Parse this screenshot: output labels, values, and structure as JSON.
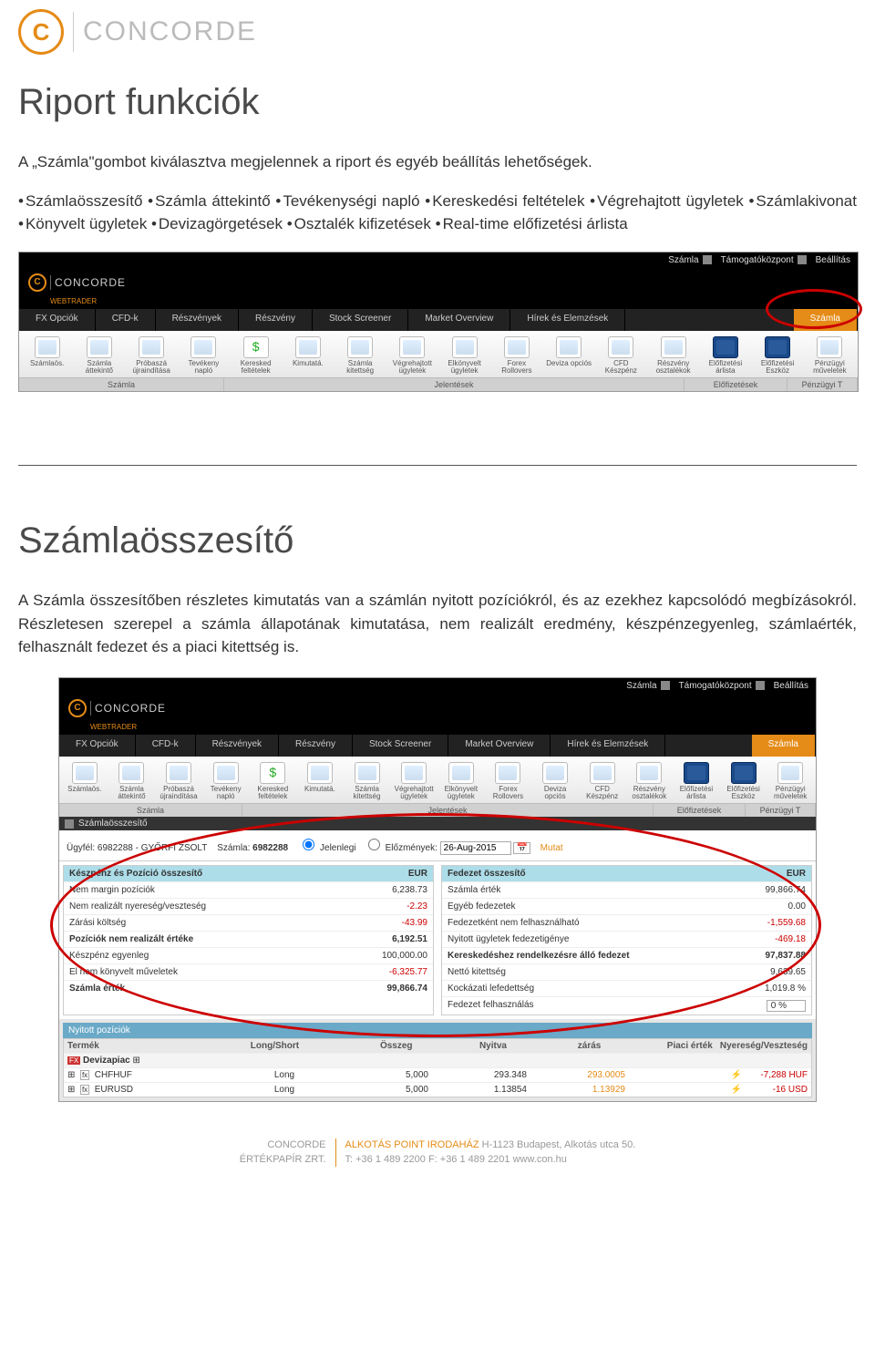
{
  "brand": {
    "name": "CONCORDE",
    "sub": "WEBTRADER"
  },
  "section1": {
    "title": "Riport funkciók",
    "intro": "A „Számla\"gombot kiválasztva megjelennek a riport és egyéb beállítás lehetőségek.",
    "bullets": [
      "Számlaösszesítő",
      "Számla áttekintő",
      "Tevékenységi napló",
      "Kereskedési feltételek",
      "Végrehajtott ügyletek",
      "Számlakivonat",
      "Könyvelt ügyletek",
      "Devizagörgetések",
      "Osztalék kifizetések",
      "Real-time előfizetési árlista"
    ]
  },
  "topbar": {
    "l1": "Számla",
    "l2": "Támogatóközpont",
    "l3": "Beállítás"
  },
  "tabs": [
    "FX Opciók",
    "CFD-k",
    "Részvények",
    "Részvény",
    "Stock Screener",
    "Market Overview",
    "Hírek és Elemzések",
    "Számla"
  ],
  "toolbar": [
    {
      "label": "Számlaös."
    },
    {
      "label": "Számla áttekintő"
    },
    {
      "label": "Próbaszá újraindítása"
    },
    {
      "label": "Tevékeny napló"
    },
    {
      "label": "Keresked feltételek"
    },
    {
      "label": "Kimutatá."
    },
    {
      "label": "Számla kitettség"
    },
    {
      "label": "Végrehajtott ügyletek"
    },
    {
      "label": "Elkönyvelt ügyletek"
    },
    {
      "label": "Forex Rollovers"
    },
    {
      "label": "Deviza opciós"
    },
    {
      "label": "CFD Készpénz"
    },
    {
      "label": "Részvény osztalékok"
    },
    {
      "label": "Előfizetési árlista"
    },
    {
      "label": "Előfizetési Eszköz"
    },
    {
      "label": "Pénzügyi műveletek"
    }
  ],
  "groups": {
    "g1": "Számla",
    "g2": "Jelentések",
    "g3": "Előfizetések",
    "g4": "Pénzügyi T"
  },
  "section2": {
    "title": "Számlaösszesítő",
    "body": "A Számla összesítőben részletes kimutatás van a számlán nyitott pozíciókról, és az ezekhez kapcsolódó megbízásokról. Részletesen szerepel a számla állapotának kimutatása, nem realizált eredmény, készpénzegyenleg, számlaérték, felhasznált fedezet és a piaci kitettség is."
  },
  "panel": {
    "title": "Számlaösszesítő",
    "filter": {
      "ugyfel_lbl": "Ügyfél:",
      "ugyfel_val": "6982288 - GYŐRFI ZSOLT",
      "szamla_lbl": "Számla:",
      "szamla_val": "6982288",
      "jelenl": "Jelenlegi",
      "elozm": "Előzmények:",
      "date": "26-Aug-2015",
      "mutat": "Mutat"
    }
  },
  "left": {
    "head": "Készpénz és Pozíció összesítő",
    "cur": "EUR",
    "rows": [
      {
        "l": "Nem margin pozíciók",
        "v": "6,238.73"
      },
      {
        "l": "Nem realizált nyereség/veszteség",
        "v": "-2.23",
        "neg": true
      },
      {
        "l": "Zárási költség",
        "v": "-43.99",
        "neg": true
      },
      {
        "l": "Pozíciók nem realizált értéke",
        "v": "6,192.51",
        "b": true
      },
      {
        "l": "Készpénz egyenleg",
        "v": "100,000.00"
      },
      {
        "l": "El nem könyvelt műveletek",
        "v": "-6,325.77",
        "neg": true
      },
      {
        "l": "Számla érték",
        "v": "99,866.74",
        "b": true
      }
    ]
  },
  "right": {
    "head": "Fedezet összesítő",
    "cur": "EUR",
    "rows": [
      {
        "l": "Számla érték",
        "v": "99,866.74"
      },
      {
        "l": "Egyéb fedezetek",
        "v": "0.00"
      },
      {
        "l": "Fedezetként nem felhasználható",
        "v": "-1,559.68",
        "neg": true
      },
      {
        "l": "Nyitott ügyletek fedezetigénye",
        "v": "-469.18",
        "neg": true
      },
      {
        "l": "Kereskedéshez rendelkezésre álló fedezet",
        "v": "97,837.88",
        "b": true
      },
      {
        "l": "Nettó kitettség",
        "v": "9,639.65"
      },
      {
        "l": "Kockázati lefedettség",
        "v": "1,019.8 %"
      },
      {
        "l": "Fedezet felhasználás",
        "v": "0 %"
      }
    ]
  },
  "positions": {
    "head": "Nyitott pozíciók",
    "cols": {
      "prod": "Termék",
      "ls": "Long/Short",
      "amt": "Összeg",
      "open": "Nyitva",
      "close": "zárás",
      "mkt": "Piaci érték",
      "pl": "Nyereség/Veszteség"
    },
    "group": "Devizapiac",
    "rows": [
      {
        "prod": "CHFHUF",
        "ls": "Long",
        "amt": "5,000",
        "open": "293.348",
        "close": "293.0005",
        "pl": "-7,288 HUF"
      },
      {
        "prod": "EURUSD",
        "ls": "Long",
        "amt": "5,000",
        "open": "1.13854",
        "close": "1.13929",
        "pl": "-16 USD"
      }
    ]
  },
  "footer": {
    "name": "CONCORDE",
    "sub": "ÉRTÉKPAPÍR ZRT.",
    "addr_lbl": "ALKOTÁS POINT IRODAHÁZ",
    "addr": "H-1123 Budapest, Alkotás utca 50.",
    "tel": "T: +36 1 489 2200  F: +36 1 489 2201  www.con.hu"
  }
}
